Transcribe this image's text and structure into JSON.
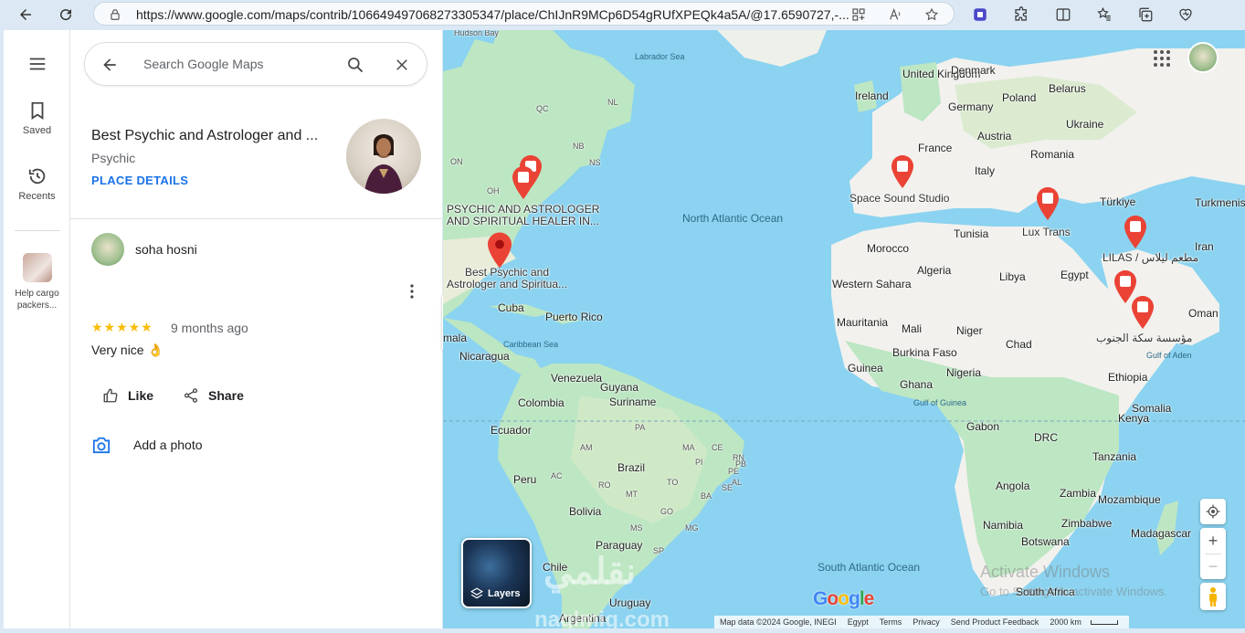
{
  "browser": {
    "url": "https://www.google.com/maps/contrib/106649497068273305347/place/ChIJnR9MCp6D54gRUfXPEQk4a5A/@17.6590727,-..."
  },
  "rail": {
    "saved_label": "Saved",
    "recents_label": "Recents",
    "recent_place_label": "Help cargo packers..."
  },
  "search": {
    "placeholder": "Search Google Maps"
  },
  "place": {
    "title": "Best Psychic and Astrologer and ...",
    "category": "Psychic",
    "details_link": "PLACE DETAILS"
  },
  "review": {
    "author": "soha hosni",
    "stars": "★★★★★",
    "rating": 5,
    "time": "9 months ago",
    "text": "Very nice 👌",
    "like_label": "Like",
    "share_label": "Share",
    "add_photo_label": "Add a photo"
  },
  "map": {
    "layers_label": "Layers",
    "google_logo": "Google",
    "activate_title": "Activate Windows",
    "activate_sub": "Go to Settings to activate Windows.",
    "attribution": [
      "Map data ©2024 Google, INEGI",
      "Egypt",
      "Terms",
      "Privacy",
      "Send Product Feedback",
      "2000 km"
    ],
    "pins": [
      {
        "label": "PSYCHIC AND ASTROLOGER AND SPIRITUAL HEALER IN..."
      },
      {
        "label": "Best Psychic and Astrologer and Spiritua..."
      },
      {
        "label": "Space Sound Studio"
      },
      {
        "label": "Lux Trans"
      },
      {
        "label": "LILAS / مطعم ليلاس"
      },
      {
        "label": "مؤسسة سكة الجنوب"
      }
    ],
    "labels": {
      "hudson_bay": "Hudson Bay",
      "labrador_sea": "Labrador Sea",
      "north_atlantic": "North Atlantic Ocean",
      "caribbean": "Caribbean Sea",
      "south_atlantic": "South Atlantic Ocean",
      "gulf_aden": "Gulf of Aden",
      "gulf_guinea": "Gulf of Guinea",
      "qc": "QC",
      "nl": "NL",
      "nb": "NB",
      "ns": "NS",
      "on": "ON",
      "oh": "OH",
      "cuba": "Cuba",
      "puerto_rico": "Puerto Rico",
      "nicaragua": "Nicaragua",
      "mala": "mala",
      "venezuela": "Venezuela",
      "guyana": "Guyana",
      "suriname": "Suriname",
      "colombia": "Colombia",
      "ecuador": "Ecuador",
      "peru": "Peru",
      "brazil": "Brazil",
      "bolivia": "Bolivia",
      "paraguay": "Paraguay",
      "chile": "Chile",
      "uruguay": "Uruguay",
      "argentina": "Argentina",
      "am": "AM",
      "pa": "PA",
      "ma": "MA",
      "ce": "CE",
      "pi": "PI",
      "pe": "PE",
      "ba": "BA",
      "to": "TO",
      "mt": "MT",
      "go": "GO",
      "mg": "MG",
      "ms": "MS",
      "sp": "SP",
      "rn": "RN",
      "pb": "PB",
      "al": "AL",
      "se": "SE",
      "ro": "RO",
      "ac": "AC",
      "united_kingdom": "United Kingdom",
      "ireland": "Ireland",
      "denmark": "Denmark",
      "belarus": "Belarus",
      "poland": "Poland",
      "germany": "Germany",
      "ukraine": "Ukraine",
      "austria": "Austria",
      "france": "France",
      "romania": "Romania",
      "italy": "Italy",
      "turkiye": "Türkiye",
      "turkmenis": "Turkmenis",
      "iran": "Iran",
      "tunisia": "Tunisia",
      "morocco": "Morocco",
      "algeria": "Algeria",
      "libya": "Libya",
      "egypt": "Egypt",
      "western_sahara": "Western Sahara",
      "mauritania": "Mauritania",
      "mali": "Mali",
      "niger": "Niger",
      "chad": "Chad",
      "burkina_faso": "Burkina Faso",
      "guinea": "Guinea",
      "nigeria": "Nigeria",
      "ghana": "Ghana",
      "ethiopia": "Ethiopia",
      "somalia": "Somalia",
      "kenya": "Kenya",
      "gabon": "Gabon",
      "drc": "DRC",
      "tanzania": "Tanzania",
      "oman": "Oman",
      "angola": "Angola",
      "zambia": "Zambia",
      "mozambique": "Mozambique",
      "namibia": "Namibia",
      "zimbabwe": "Zimbabwe",
      "botswana": "Botswana",
      "madagascar": "Madagascar",
      "south_africa": "South Africa"
    }
  },
  "colors": {
    "water": "#8bd3f0",
    "land": "#f2f1ee",
    "green": "#bde6c3",
    "pin": "#ea4335",
    "link": "#1a73e8",
    "star": "#fbbc04"
  }
}
